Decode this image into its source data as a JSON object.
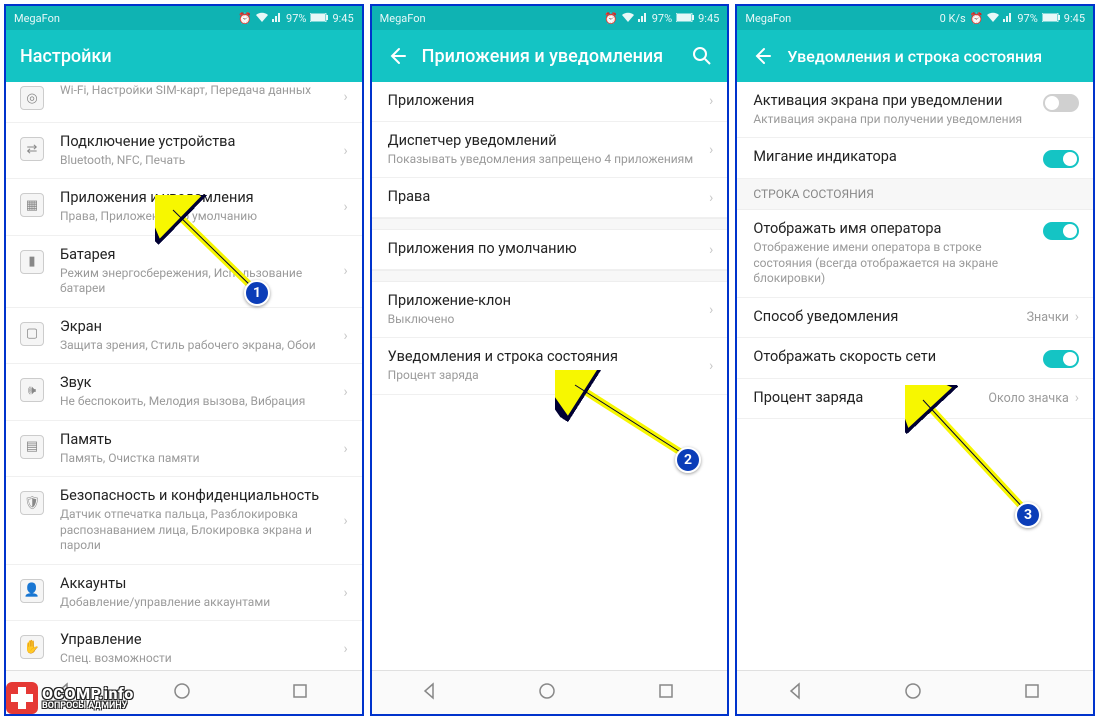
{
  "statusbar": {
    "carrier": "MegaFon",
    "battery_pct": "97%",
    "time": "9:45",
    "speed": "0 K/s"
  },
  "screen1": {
    "title": "Настройки",
    "items": [
      {
        "title": "Wi-Fi, Настройки SIM-карт, Передача данных",
        "sub": "",
        "partial": true,
        "icon": "◎"
      },
      {
        "title": "Подключение устройства",
        "sub": "Bluetooth, NFC, Печать",
        "icon": "⇄"
      },
      {
        "title": "Приложения и уведомления",
        "sub": "Права, Приложения по умолчанию",
        "icon": "▦"
      },
      {
        "title": "Батарея",
        "sub": "Режим энергосбережения, Использование батареи",
        "icon": "▮"
      },
      {
        "title": "Экран",
        "sub": "Защита зрения, Стиль рабочего экрана, Обои",
        "icon": "▢"
      },
      {
        "title": "Звук",
        "sub": "Не беспокоить, Мелодия вызова, Вибрация",
        "icon": "🕪"
      },
      {
        "title": "Память",
        "sub": "Память, Очистка памяти",
        "icon": "▤"
      },
      {
        "title": "Безопасность и конфиденциальность",
        "sub": "Датчик отпечатка пальца, Разблокировка распознаванием лица, Блокировка экрана и пароли",
        "icon": "🛡"
      },
      {
        "title": "Аккаунты",
        "sub": "Добавление/управление аккаунтами",
        "icon": "👤"
      },
      {
        "title": "Управление",
        "sub": "Спец. возможности",
        "icon": "✋"
      }
    ]
  },
  "screen2": {
    "title": "Приложения и уведомления",
    "items": [
      {
        "title": "Приложения",
        "sub": ""
      },
      {
        "title": "Диспетчер уведомлений",
        "sub": "Показывать уведомления запрещено 4 приложениям"
      },
      {
        "title": "Права",
        "sub": ""
      },
      {
        "title": "Приложения по умолчанию",
        "sub": ""
      },
      {
        "title": "Приложение-клон",
        "sub": "Выключено"
      },
      {
        "title": "Уведомления и строка состояния",
        "sub": "Процент заряда"
      }
    ]
  },
  "screen3": {
    "title": "Уведомления и строка состояния",
    "section_header": "СТРОКА СОСТОЯНИЯ",
    "items_top": [
      {
        "title": "Активация экрана при уведомлении",
        "sub": "Активация экрана при получении уведомления",
        "toggle": "off"
      },
      {
        "title": "Мигание индикатора",
        "sub": "",
        "toggle": "on"
      }
    ],
    "items_section": [
      {
        "title": "Отображать имя оператора",
        "sub": "Отображение имени оператора в строке состояния (всегда отображается на экране блокировки)",
        "toggle": "on"
      },
      {
        "title": "Способ уведомления",
        "value": "Значки"
      },
      {
        "title": "Отображать скорость сети",
        "toggle": "on"
      },
      {
        "title": "Процент заряда",
        "value": "Около значка"
      }
    ]
  },
  "badges": {
    "b1": "1",
    "b2": "2",
    "b3": "3"
  },
  "watermark": {
    "line1": "OCOMP.info",
    "line2": "ВОПРОСЫ АДМИНУ"
  }
}
